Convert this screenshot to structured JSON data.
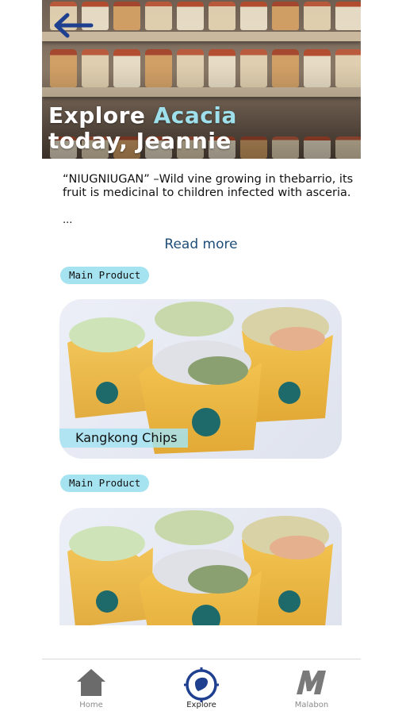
{
  "hero": {
    "title_line1_prefix": "Explore",
    "title_line1_accent": "Acacia",
    "title_line2": "today, Jeannie",
    "back_icon": "arrow-left-icon"
  },
  "description": {
    "text": "“NIUGNIUGAN” –Wild vine growing in thebarrio, its fruit is medicinal to children infected with asceria.",
    "ellipsis": "...",
    "read_more": "Read more"
  },
  "products": [
    {
      "badge": "Main Product",
      "name": "Kangkong Chips"
    },
    {
      "badge": "Main Product",
      "name": ""
    }
  ],
  "colors": {
    "accent": "#9ee0ec",
    "badge_bg": "#a6e3f1",
    "link": "#1f4e79",
    "nav_active": "#1f3f8f",
    "nav_inactive": "#7a7a7a"
  },
  "nav": {
    "items": [
      {
        "label": "Home",
        "icon": "home-icon"
      },
      {
        "label": "Explore",
        "icon": "explore-compass-icon"
      },
      {
        "label": "Malabon",
        "icon": "malabon-logo-icon"
      }
    ],
    "active": "Explore"
  }
}
